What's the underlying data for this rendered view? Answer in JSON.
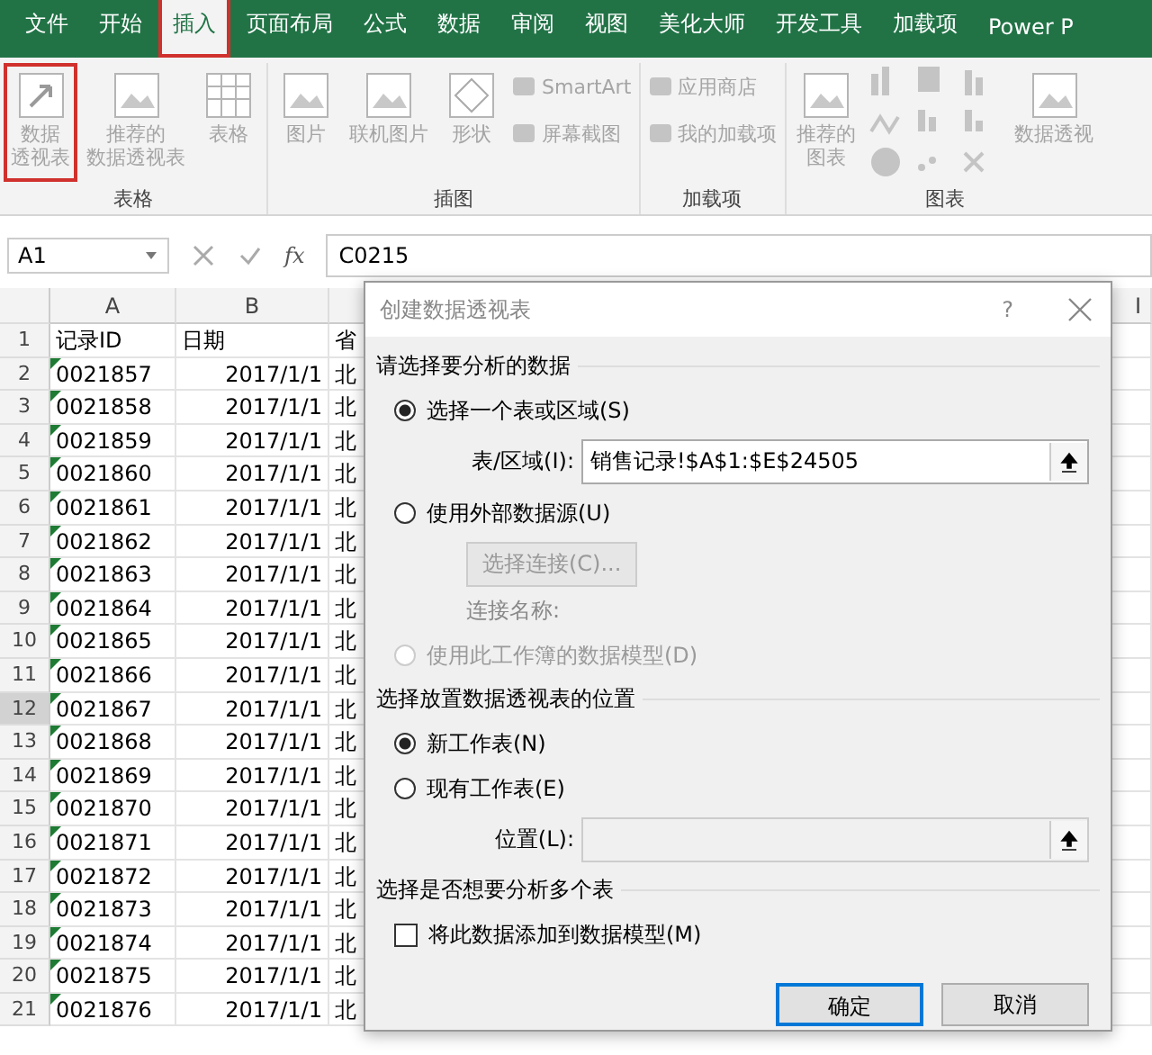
{
  "ribbon_tabs": [
    {
      "label": "文件",
      "selected": false,
      "highlighted": false
    },
    {
      "label": "开始",
      "selected": false,
      "highlighted": false
    },
    {
      "label": "插入",
      "selected": true,
      "highlighted": true
    },
    {
      "label": "页面布局",
      "selected": false,
      "highlighted": false
    },
    {
      "label": "公式",
      "selected": false,
      "highlighted": false
    },
    {
      "label": "数据",
      "selected": false,
      "highlighted": false
    },
    {
      "label": "审阅",
      "selected": false,
      "highlighted": false
    },
    {
      "label": "视图",
      "selected": false,
      "highlighted": false
    },
    {
      "label": "美化大师",
      "selected": false,
      "highlighted": false
    },
    {
      "label": "开发工具",
      "selected": false,
      "highlighted": false
    },
    {
      "label": "加载项",
      "selected": false,
      "highlighted": false
    },
    {
      "label": "Power P",
      "selected": false,
      "highlighted": false
    }
  ],
  "ribbon_groups": [
    {
      "label": "表格",
      "commands": [
        {
          "kind": "large",
          "lines": [
            "数据",
            "透视表"
          ],
          "highlighted": true
        },
        {
          "kind": "large",
          "lines": [
            "推荐的",
            "数据透视表"
          ],
          "highlighted": false
        },
        {
          "kind": "large",
          "lines": [
            "表格"
          ],
          "highlighted": false
        }
      ]
    },
    {
      "label": "插图",
      "commands": [
        {
          "kind": "large",
          "lines": [
            "图片"
          ],
          "highlighted": false
        },
        {
          "kind": "large",
          "lines": [
            "联机图片"
          ],
          "highlighted": false
        },
        {
          "kind": "large",
          "lines": [
            "形状"
          ],
          "highlighted": false
        },
        {
          "kind": "stack",
          "items": [
            "SmartArt",
            "屏幕截图"
          ]
        }
      ]
    },
    {
      "label": "加载项",
      "commands": [
        {
          "kind": "stack",
          "items": [
            "应用商店",
            "我的加载项"
          ]
        }
      ]
    },
    {
      "label": "图表",
      "commands": [
        {
          "kind": "large",
          "lines": [
            "推荐的",
            "图表"
          ],
          "highlighted": false
        },
        {
          "kind": "charts"
        },
        {
          "kind": "large",
          "lines": [
            "数据透视"
          ],
          "highlighted": false
        }
      ]
    }
  ],
  "formula_bar": {
    "name_box": "A1",
    "fx": "fx",
    "value": "C0215"
  },
  "columns": [
    "A",
    "B"
  ],
  "right_column": "I",
  "rows": [
    {
      "header": "1",
      "selected": false,
      "warning": false,
      "cells": [
        "记录ID",
        "日期",
        "省"
      ]
    },
    {
      "header": "2",
      "selected": false,
      "warning": true,
      "cells": [
        "0021857",
        "2017/1/1",
        "北"
      ]
    },
    {
      "header": "3",
      "selected": false,
      "warning": true,
      "cells": [
        "0021858",
        "2017/1/1",
        "北"
      ]
    },
    {
      "header": "4",
      "selected": false,
      "warning": true,
      "cells": [
        "0021859",
        "2017/1/1",
        "北"
      ]
    },
    {
      "header": "5",
      "selected": false,
      "warning": true,
      "cells": [
        "0021860",
        "2017/1/1",
        "北"
      ]
    },
    {
      "header": "6",
      "selected": false,
      "warning": true,
      "cells": [
        "0021861",
        "2017/1/1",
        "北"
      ]
    },
    {
      "header": "7",
      "selected": false,
      "warning": true,
      "cells": [
        "0021862",
        "2017/1/1",
        "北"
      ]
    },
    {
      "header": "8",
      "selected": false,
      "warning": true,
      "cells": [
        "0021863",
        "2017/1/1",
        "北"
      ]
    },
    {
      "header": "9",
      "selected": false,
      "warning": true,
      "cells": [
        "0021864",
        "2017/1/1",
        "北"
      ]
    },
    {
      "header": "10",
      "selected": false,
      "warning": true,
      "cells": [
        "0021865",
        "2017/1/1",
        "北"
      ]
    },
    {
      "header": "11",
      "selected": false,
      "warning": true,
      "cells": [
        "0021866",
        "2017/1/1",
        "北"
      ]
    },
    {
      "header": "12",
      "selected": true,
      "warning": true,
      "cells": [
        "0021867",
        "2017/1/1",
        "北"
      ]
    },
    {
      "header": "13",
      "selected": false,
      "warning": true,
      "cells": [
        "0021868",
        "2017/1/1",
        "北"
      ]
    },
    {
      "header": "14",
      "selected": false,
      "warning": true,
      "cells": [
        "0021869",
        "2017/1/1",
        "北"
      ]
    },
    {
      "header": "15",
      "selected": false,
      "warning": true,
      "cells": [
        "0021870",
        "2017/1/1",
        "北"
      ]
    },
    {
      "header": "16",
      "selected": false,
      "warning": true,
      "cells": [
        "0021871",
        "2017/1/1",
        "北"
      ]
    },
    {
      "header": "17",
      "selected": false,
      "warning": true,
      "cells": [
        "0021872",
        "2017/1/1",
        "北"
      ]
    },
    {
      "header": "18",
      "selected": false,
      "warning": true,
      "cells": [
        "0021873",
        "2017/1/1",
        "北"
      ]
    },
    {
      "header": "19",
      "selected": false,
      "warning": true,
      "cells": [
        "0021874",
        "2017/1/1",
        "北"
      ]
    },
    {
      "header": "20",
      "selected": false,
      "warning": true,
      "cells": [
        "0021875",
        "2017/1/1",
        "北"
      ]
    },
    {
      "header": "21",
      "selected": false,
      "warning": true,
      "cells": [
        "0021876",
        "2017/1/1",
        "北"
      ]
    }
  ],
  "dialog": {
    "title": "创建数据透视表",
    "help": "?",
    "sections": [
      {
        "heading": "请选择要分析的数据",
        "items": [
          {
            "kind": "radio",
            "label": "选择一个表或区域(S)",
            "selected": true,
            "disabled": false
          },
          {
            "kind": "field",
            "label": "表/区域(I):",
            "value": "销售记录!$A$1:$E$24505",
            "disabled": false
          },
          {
            "kind": "radio",
            "label": "使用外部数据源(U)",
            "selected": false,
            "disabled": false
          },
          {
            "kind": "button",
            "label": "选择连接(C)...",
            "disabled": true
          },
          {
            "kind": "note",
            "label": "连接名称:",
            "disabled": true
          },
          {
            "kind": "radio",
            "label": "使用此工作簿的数据模型(D)",
            "selected": false,
            "disabled": true
          }
        ]
      },
      {
        "heading": "选择放置数据透视表的位置",
        "items": [
          {
            "kind": "radio",
            "label": "新工作表(N)",
            "selected": true,
            "disabled": false
          },
          {
            "kind": "radio",
            "label": "现有工作表(E)",
            "selected": false,
            "disabled": false
          },
          {
            "kind": "field",
            "label": "位置(L):",
            "value": "",
            "disabled": true
          }
        ]
      },
      {
        "heading": "选择是否想要分析多个表",
        "items": [
          {
            "kind": "checkbox",
            "label": "将此数据添加到数据模型(M)",
            "checked": false,
            "disabled": false
          }
        ]
      }
    ],
    "buttons": [
      {
        "label": "确定",
        "default": true
      },
      {
        "label": "取消",
        "default": false
      }
    ]
  }
}
